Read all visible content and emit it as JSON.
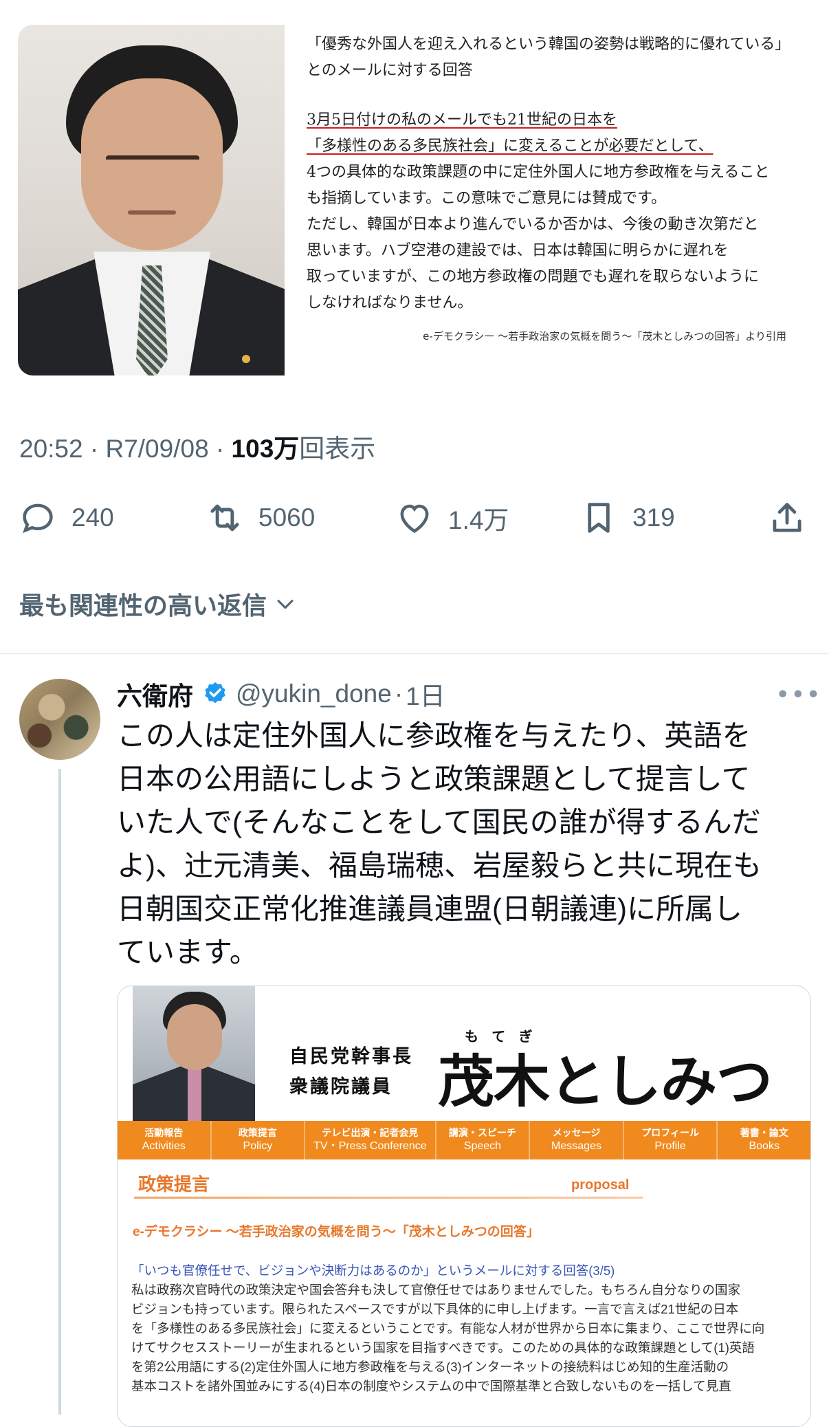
{
  "top_image": {
    "quote_head": [
      "「優秀な外国人を迎え入れるという韓国の姿勢は戦略的に優れている」",
      "とのメールに対する回答"
    ],
    "quote_body": [
      "3月5日付けの私のメールでも21世紀の日本を",
      "「多様性のある多民族社会」に変えることが必要だとして、",
      "4つの具体的な政策課題の中に定住外国人に地方参政権を与えること",
      "も指摘しています。この意味でご意見には賛成です。",
      "ただし、韓国が日本より進んでいるか否かは、今後の動き次第だと",
      "思います。ハブ空港の建設では、日本は韓国に明らかに遅れを",
      "取っていますが、この地方参政権の問題でも遅れを取らないように",
      "しなければなりません。"
    ],
    "source": "e-デモクラシー ～若手政治家の気概を問う～「茂木としみつの回答」より引用"
  },
  "meta": {
    "time": "20:52",
    "date": "R7/09/08",
    "views": "103万",
    "views_label": "回表示",
    "separator": " · "
  },
  "actions": {
    "replies": "240",
    "reposts": "5060",
    "likes": "1.4万",
    "bookmarks": "319"
  },
  "relevant_replies_label": "最も関連性の高い返信",
  "reply": {
    "name": "六衛府",
    "handle": "@yukin_done",
    "time": "1日",
    "separator": "·",
    "more": "•••",
    "text_lines": [
      "この人は定住外国人に参政権を与えたり、英語を",
      "日本の公用語にしようと政策課題として提言して",
      "いた人で(そんなことをして国民の誰が得するんだ",
      "よ)、辻元清美、福島瑞穂、岩屋毅らと共に現在も",
      "日朝国交正常化推進議員連盟(日朝議連)に所属し",
      "ています。"
    ]
  },
  "embed": {
    "title_small": [
      "自民党幹事長",
      "衆議院議員"
    ],
    "ruby": "もてぎ",
    "title_big": "茂木としみつ",
    "nav": [
      {
        "jp": "活動報告",
        "en": "Activities"
      },
      {
        "jp": "政策提言",
        "en": "Policy"
      },
      {
        "jp": "テレビ出演・記者会見",
        "en": "TV・Press Conference"
      },
      {
        "jp": "講演・スピーチ",
        "en": "Speech"
      },
      {
        "jp": "メッセージ",
        "en": "Messages"
      },
      {
        "jp": "プロフィール",
        "en": "Profile"
      },
      {
        "jp": "著書・論文",
        "en": "Books"
      }
    ],
    "policy_title": "政策提言",
    "proposal": "proposal",
    "edemo": "e-デモクラシー 〜若手政治家の気概を問う〜「茂木としみつの回答」",
    "body_first": "「いつも官僚任せで、ビジョンや決断力はあるのか」というメールに対する回答(3/5)",
    "body_lines": [
      "私は政務次官時代の政策決定や国会答弁も決して官僚任せではありませんでした。もちろん自分なりの国家",
      "ビジョンも持っています。限られたスペースですが以下具体的に申し上げます。一言で言えば21世紀の日本",
      "を「多様性のある多民族社会」に変えるということです。有能な人材が世界から日本に集まり、ここで世界に向",
      "けてサクセスストーリーが生まれるという国家を目指すべきです。このための具体的な政策課題として(1)英語",
      "を第2公用語にする(2)定住外国人に地方参政権を与える(3)インターネットの接続料はじめ知的生産活動の",
      "基本コストを諸外国並みにする(4)日本の制度やシステムの中で国際基準と合致しないものを一括して見直"
    ]
  },
  "colors": {
    "text_primary": "#0f1419",
    "text_secondary": "#536471",
    "verified": "#1d9bf0",
    "site_orange": "#f08a1f",
    "underline_red": "#d11b1b"
  }
}
